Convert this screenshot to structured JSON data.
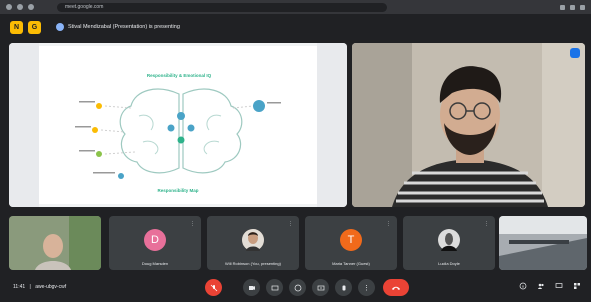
{
  "browser": {
    "url": "meet.google.com"
  },
  "header": {
    "btn_1": "N",
    "btn_2": "G",
    "presenting_text": "Stival Mendizabal (Presentation) is presenting"
  },
  "slide": {
    "title": "Responsibility & Emotional IQ",
    "bottom_title": "Responsibility Map"
  },
  "participants": [
    {
      "name": "",
      "type": "video"
    },
    {
      "name": "Doug Marsden",
      "type": "avatar",
      "initial": "D",
      "color": "#e8709a"
    },
    {
      "name": "Will Robinson (You, presenting)",
      "type": "photo"
    },
    {
      "name": "Maria Tanner (Guest)",
      "type": "avatar",
      "initial": "T",
      "color": "#f16a1b"
    },
    {
      "name": "Lucila Doyle",
      "type": "photo"
    },
    {
      "name": "",
      "type": "video"
    }
  ],
  "bottom": {
    "time": "11:41",
    "meeting_code": "awe-ubgv-cwf",
    "leave_icon": "call-end-icon"
  },
  "colors": {
    "accent": "#1a73e8",
    "leave_red": "#ea4335",
    "slide_green": "#2db28a",
    "slide_blue": "#4aa3c7"
  }
}
